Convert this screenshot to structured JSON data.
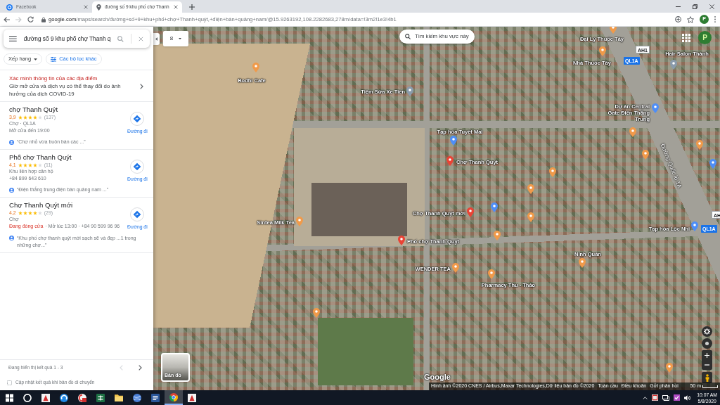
{
  "browser": {
    "tabs": [
      {
        "title": "Facebook",
        "kind": "social",
        "selected": false
      },
      {
        "title": "đường số 9 khu phố chợ Thanh",
        "kind": "maps",
        "selected": true
      }
    ],
    "url_host": "google.com",
    "url_path": "/maps/search/đường+số+9+khu+phố+chợ+Thanh+quýt,+điện+bàn+quảng+nam/@15.9263192,108.2282683,278m/data=!3m2!1e3!4b1",
    "profile_initial": "P"
  },
  "sidebar": {
    "search": {
      "value": "đường số 9 khu phố chợ Thanh q"
    },
    "filters": [
      {
        "label": "Xếp hạng",
        "kind": "dropdown"
      },
      {
        "label": "Các bộ lọc khác",
        "kind": "filter"
      }
    ],
    "notice": {
      "title": "Xác minh thông tin của các địa điểm",
      "text": "Giờ mở cửa và dịch vụ có thể thay đổi do ảnh hưởng của dịch COVID-19"
    },
    "results": [
      {
        "name": "chợ Thanh Quýt",
        "rating": "3,9",
        "stars": 4,
        "review_count": "(137)",
        "details": [
          {
            "text": "Chợ · QL1A"
          },
          {
            "text": "Mở cửa đến 19:00"
          }
        ],
        "review": "“Chợ nhỏ vừa buôn bán các ...”",
        "directions": "Đường đi"
      },
      {
        "name": "Phố chợ Thanh Quýt",
        "rating": "4,1",
        "stars": 4,
        "review_count": "(11)",
        "details": [
          {
            "text": "Khu liên hợp căn hộ"
          },
          {
            "text": "+84 899 643 610"
          }
        ],
        "review": "“Điện thắng trung điện bàn quảng nam ...”",
        "directions": "Đường đi"
      },
      {
        "name": "Chợ Thanh Quýt mới",
        "rating": "4,2",
        "stars": 4,
        "review_count": "(29)",
        "details": [
          {
            "text": "Chợ"
          },
          {
            "status": "Đang đóng cửa",
            "open": false,
            "text": "· Mở lúc 13:00 · +84 90 599 96 96"
          }
        ],
        "review": "“Khu phố chợ thanh quýt mới sạch sẽ và đẹp ...1 trong những chợ...”",
        "directions": "Đường đi"
      }
    ],
    "pagination": {
      "text": "Đang hiển thị kết quả 1 - 3",
      "prev_disabled": true,
      "next_disabled": false
    },
    "auto_update": {
      "label": "Cập nhật kết quả khi bản đồ di chuyển",
      "checked": false
    }
  },
  "map": {
    "dropdown_label": "8",
    "search_area_button": "Tìm kiếm khu vực này",
    "profile_initial": "P",
    "pins": [
      {
        "label": "Đại Lý Thuốc Tây",
        "color": "#f09a4a"
      },
      {
        "label": "Nhà Thuốc Tây",
        "color": "#f09a4a"
      },
      {
        "label": "Hair Salon Thành",
        "color": "#8a9bab"
      },
      {
        "label": "Bodhi Cafe",
        "color": "#f09a4a"
      },
      {
        "label": "Tiệm Sửa Xe Tiến",
        "color": "#8a9bab"
      },
      {
        "label": "Dự án Central Gate Điện Thắng Trung",
        "color": "#4e8ef7"
      },
      {
        "label": "Tạp hóa Tuyết Mai",
        "color": "#4e8ef7"
      },
      {
        "color": "#f09a4a"
      },
      {
        "color": "#f09a4a"
      },
      {
        "color": "#f09a4a"
      },
      {
        "label": "Chợ Thanh Quýt",
        "color": "#ea4335"
      },
      {
        "color": "#4e8ef7"
      },
      {
        "color": "#f09a4a"
      },
      {
        "color": "#f09a4a"
      },
      {
        "color": "#4e8ef7"
      },
      {
        "label": "Chợ Thanh Quýt mới",
        "color": "#ea4335"
      },
      {
        "color": "#f09a4a"
      },
      {
        "label": "Sintea Milk Tea",
        "color": "#f09a4a"
      },
      {
        "label": "Tạp hóa Lộc Nhi",
        "color": "#4e8ef7"
      },
      {
        "color": "#f09a4a"
      },
      {
        "label": "Phố chợ Thanh Quýt",
        "color": "#ea4335"
      },
      {
        "label": "Ninh Quán",
        "color": "#f09a4a"
      },
      {
        "label": "WENDER TEA",
        "color": "#f09a4a"
      },
      {
        "label": "Pharmacy Thu - Thảo",
        "color": "#f09a4a"
      },
      {
        "color": "#f09a4a"
      },
      {
        "color": "#f09a4a"
      }
    ],
    "shields": [
      {
        "text": "QL1A",
        "kind": "national"
      },
      {
        "text": "AH1",
        "kind": "asian"
      },
      {
        "text": "AH",
        "kind": "asian"
      },
      {
        "text": "QL1A",
        "kind": "national"
      }
    ],
    "road_labels": [
      {
        "text": "Đường Quốc lộ 1A"
      }
    ],
    "layer_toggle_label": "Bản đồ",
    "logo": "Google",
    "attribution": [
      "Hình ảnh ©2020 CNES / Airbus,Maxar Technologies,Dữ liệu bản đồ ©2020",
      "Toàn cầu",
      "Điều khoản",
      "Gửi phản hồi"
    ],
    "scale_label": "50 m"
  },
  "taskbar": {
    "apps": [
      {
        "kind": "start",
        "selected": false
      },
      {
        "kind": "search",
        "selected": false
      },
      {
        "kind": "cad",
        "selected": false
      },
      {
        "kind": "edge",
        "selected": false
      },
      {
        "kind": "pdf",
        "selected": false
      },
      {
        "kind": "sheet",
        "selected": false
      },
      {
        "kind": "folder",
        "selected": false
      },
      {
        "kind": "globe",
        "selected": false
      },
      {
        "kind": "doc",
        "selected": false
      },
      {
        "kind": "chrome",
        "selected": true
      },
      {
        "kind": "cad",
        "selected": false
      }
    ],
    "time": "10:07 AM",
    "date": "5/8/2020"
  }
}
